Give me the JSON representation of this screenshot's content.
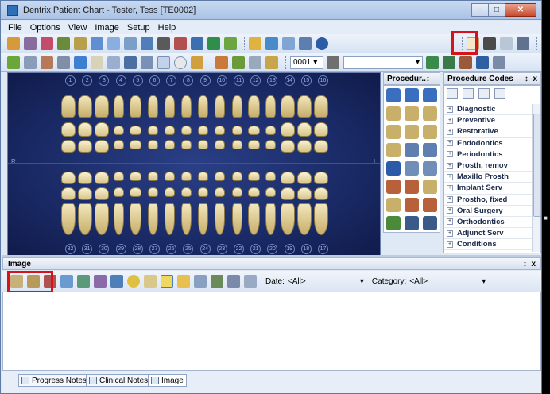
{
  "window": {
    "title": "Dentrix Patient Chart - Tester, Tess [TE0002]"
  },
  "menu": [
    "File",
    "Options",
    "View",
    "Image",
    "Setup",
    "Help"
  ],
  "toolbar": {
    "provider_value": "0001"
  },
  "tooth_numbers": {
    "upper": [
      "1",
      "2",
      "3",
      "4",
      "5",
      "6",
      "7",
      "8",
      "9",
      "10",
      "11",
      "12",
      "13",
      "14",
      "15",
      "16"
    ],
    "lower": [
      "32",
      "31",
      "30",
      "29",
      "28",
      "27",
      "26",
      "25",
      "24",
      "23",
      "22",
      "21",
      "20",
      "19",
      "18",
      "17"
    ]
  },
  "chart_sides": {
    "left": "R",
    "right": "L"
  },
  "procedure_buttons": {
    "title": "Procedur..",
    "labels": [
      "",
      "",
      "",
      "",
      "",
      "",
      "",
      "",
      "",
      "",
      "",
      "",
      "",
      "",
      "",
      "",
      "",
      ""
    ]
  },
  "procedure_codes": {
    "title": "Procedure Codes",
    "items": [
      "Diagnostic",
      "Preventive",
      "Restorative",
      "Endodontics",
      "Periodontics",
      "Prosth, remov",
      "Maxillo Prosth",
      "Implant Serv",
      "Prostho, fixed",
      "Oral Surgery",
      "Orthodontics",
      "Adjunct Serv",
      "Conditions"
    ]
  },
  "panel_controls": {
    "pin": "↕",
    "close": "x"
  },
  "image_pane": {
    "title": "Image",
    "date_label": "Date:",
    "date_value": "<All>",
    "category_label": "Category:",
    "category_value": "<All>"
  },
  "bottom_tabs": [
    "Progress Notes",
    "Clinical Notes",
    "Image"
  ],
  "highlight_color": "#d4141a"
}
